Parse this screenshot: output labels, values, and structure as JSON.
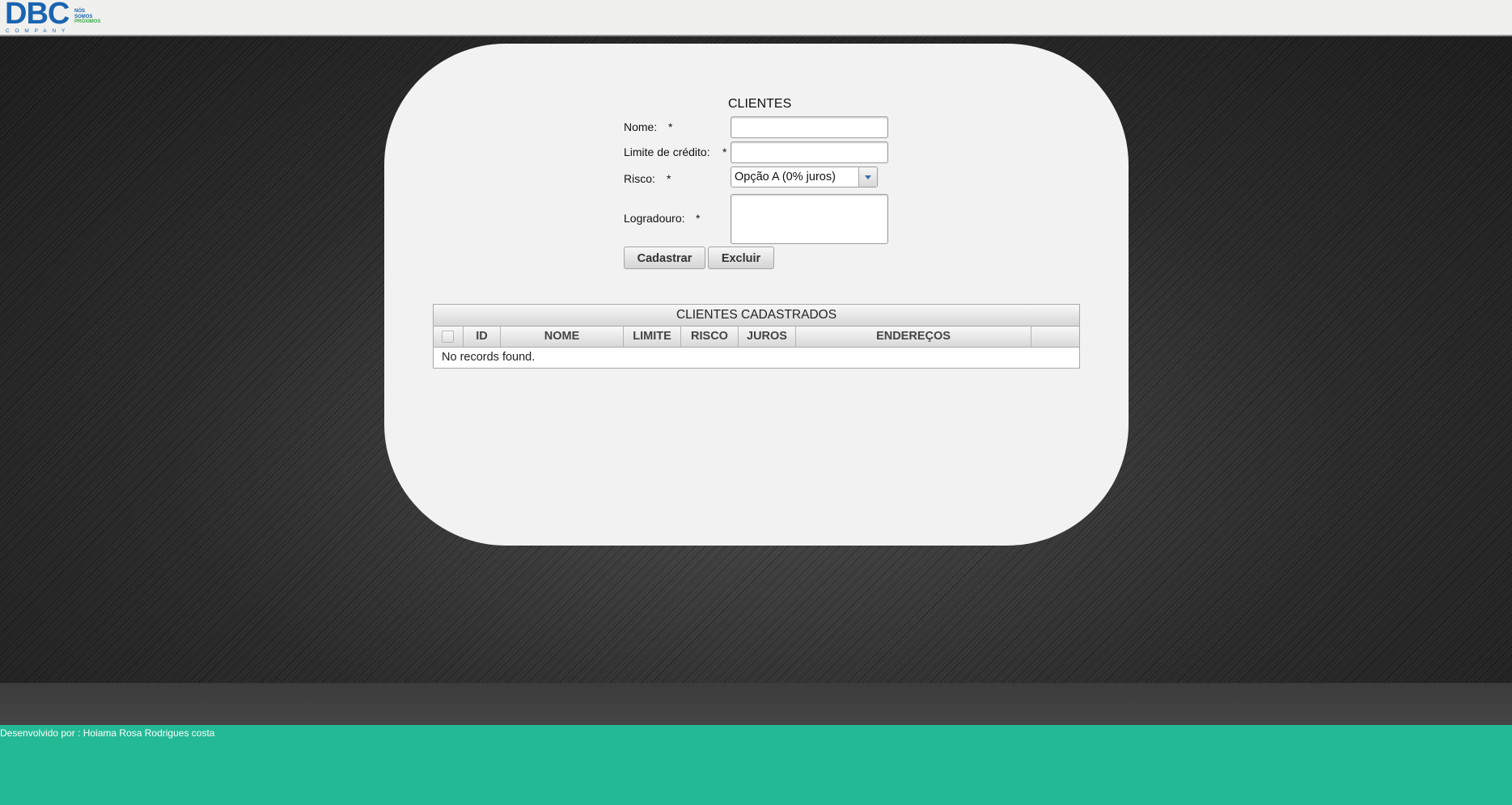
{
  "brand": {
    "logo_text": "DBC",
    "tagline": [
      "NÓS",
      "SOMOS",
      "PRÓXIMOS"
    ],
    "company": "COMPANY",
    "color": "#1a64b0"
  },
  "form": {
    "title": "CLIENTES",
    "fields": {
      "nome": {
        "label": "Nome:",
        "required": "*",
        "value": ""
      },
      "limite": {
        "label": "Limite de crédito:",
        "required": "*",
        "value": ""
      },
      "risco": {
        "label": "Risco:",
        "required": "*",
        "value": "Opção A (0% juros)"
      },
      "logradouro": {
        "label": "Logradouro:",
        "required": "*",
        "value": ""
      }
    },
    "buttons": {
      "cadastrar": "Cadastrar",
      "excluir": "Excluir"
    }
  },
  "table": {
    "caption": "CLIENTES CADASTRADOS",
    "columns": [
      "ID",
      "NOME",
      "LIMITE",
      "RISCO",
      "JUROS",
      "ENDEREÇOS"
    ],
    "empty_message": "No records found."
  },
  "footer": {
    "text": "Desenvolvido por : Hoiama Rosa Rodrigues costa",
    "color": "#23b994"
  }
}
